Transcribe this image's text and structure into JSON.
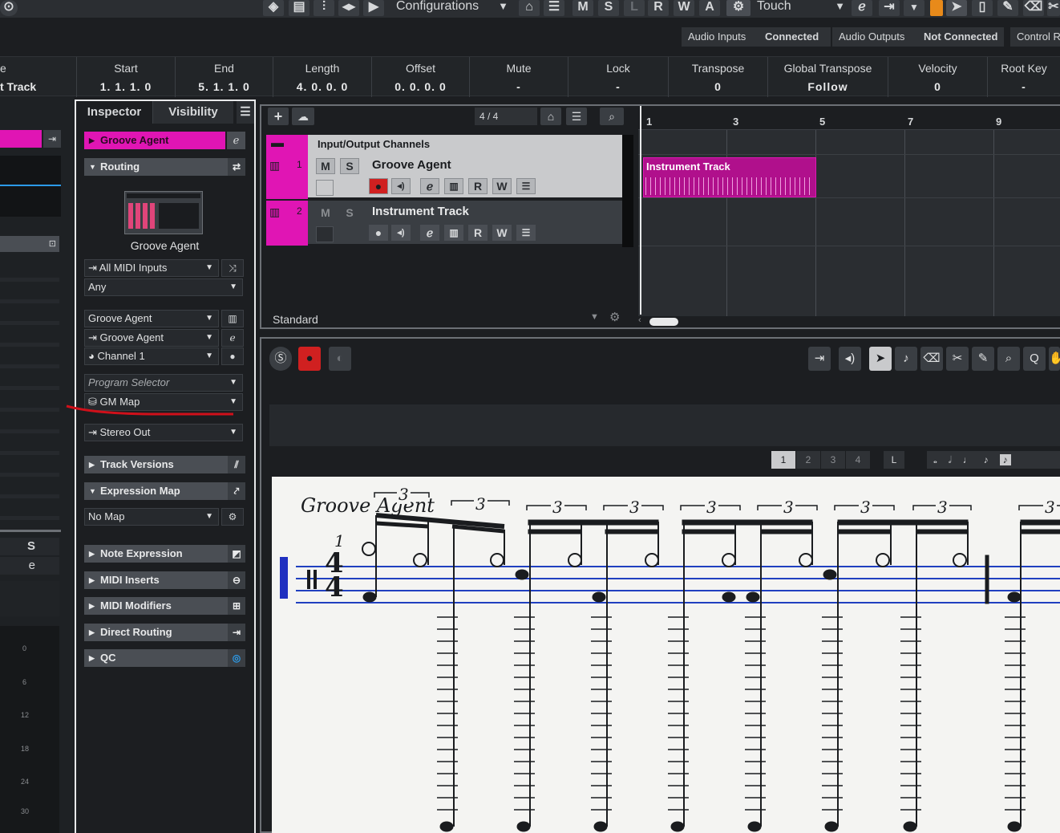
{
  "toolbar": {
    "configurations_label": "Configurations",
    "automation_mode": "Touch",
    "msl_buttons": [
      "M",
      "S",
      "L",
      "R",
      "W",
      "A"
    ]
  },
  "status": {
    "audio_inputs_label": "Audio Inputs",
    "audio_inputs_state": "Connected",
    "audio_outputs_label": "Audio Outputs",
    "audio_outputs_state": "Not Connected",
    "control_label": "Control R"
  },
  "infoline": {
    "name_label": "e",
    "name_value": "t Track",
    "columns": [
      {
        "label": "Start",
        "value": "1. 1. 1.   0"
      },
      {
        "label": "End",
        "value": "5. 1. 1.   0"
      },
      {
        "label": "Length",
        "value": "4. 0. 0.   0"
      },
      {
        "label": "Offset",
        "value": "0. 0. 0.   0"
      },
      {
        "label": "Mute",
        "value": "-"
      },
      {
        "label": "Lock",
        "value": "-"
      },
      {
        "label": "Transpose",
        "value": "0"
      },
      {
        "label": "Global Transpose",
        "value": "Follow"
      },
      {
        "label": "Velocity",
        "value": "0"
      },
      {
        "label": "Root Key",
        "value": "-"
      }
    ]
  },
  "leftstrip": {
    "s_label": "S",
    "e_label": "e",
    "meter_scale": [
      "0",
      "6",
      "12",
      "18",
      "24",
      "30"
    ]
  },
  "inspector": {
    "tab_inspector": "Inspector",
    "tab_visibility": "Visibility",
    "track_name": "Groove Agent",
    "routing_label": "Routing",
    "instrument_name": "Groove Agent",
    "midi_input": "All MIDI Inputs",
    "midi_channel_in": "Any",
    "output": "Groove Agent",
    "edit_instrument": "Groove Agent",
    "channel": "Channel 1",
    "program_selector": "Program Selector",
    "patch_map": "GM Map",
    "audio_out": "Stereo Out",
    "track_versions": "Track Versions",
    "expression_map": "Expression Map",
    "no_map": "No Map",
    "note_expression": "Note Expression",
    "midi_inserts": "MIDI Inserts",
    "midi_modifiers": "MIDI Modifiers",
    "direct_routing": "Direct Routing",
    "qc": "QC",
    "accent_color": "#e015b4"
  },
  "project": {
    "signature": "4 / 4",
    "folder_name": "Input/Output Channels",
    "tracks": [
      {
        "number": "1",
        "name": "Groove Agent"
      },
      {
        "number": "2",
        "name": "Instrument Track"
      }
    ],
    "standard_label": "Standard",
    "ruler": [
      "1",
      "3",
      "5",
      "7",
      "9"
    ],
    "part_name": "Instrument Track"
  },
  "editor": {
    "pages": [
      "1",
      "2",
      "3",
      "4"
    ],
    "l_label": "L",
    "score_title": "Groove Agent",
    "bar_number": "1",
    "time_sig_top": "4",
    "time_sig_bottom": "4",
    "triplet": "3"
  }
}
